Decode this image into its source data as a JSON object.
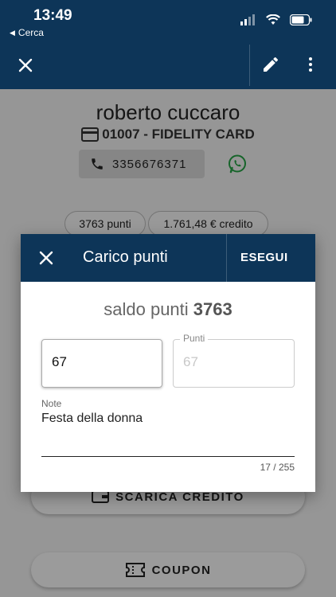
{
  "status_bar": {
    "time": "13:49",
    "back_label": "Cerca"
  },
  "customer": {
    "name": "roberto cuccaro",
    "card": "01007 - FIDELITY CARD",
    "phone": "3356676371",
    "points_chip": "3763 punti",
    "credit_chip": "1.761,48 € credito"
  },
  "background_buttons": {
    "credit_label": "SCARICA CREDITO",
    "coupon_label": "COUPON"
  },
  "dialog": {
    "title": "Carico punti",
    "execute_label": "ESEGUI",
    "saldo_prefix": "saldo punti",
    "saldo_value": "3763",
    "amount_value": "67",
    "points_label": "Punti",
    "points_value": "67",
    "note_label": "Note",
    "note_value": "Festa della donna",
    "note_counter": "17 / 255"
  },
  "colors": {
    "primary": "#0d3558",
    "whatsapp": "#25a244"
  }
}
